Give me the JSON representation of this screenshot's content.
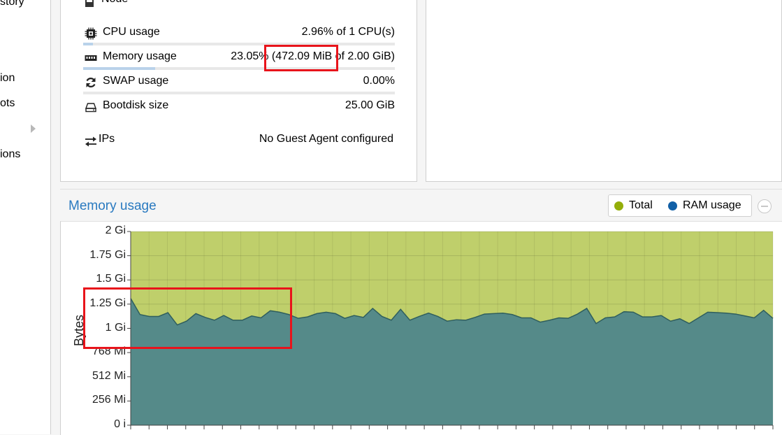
{
  "sidebar": {
    "items": [
      {
        "label": "story"
      },
      {
        "label": "ion"
      },
      {
        "label": "ots"
      },
      {
        "label": "ions"
      }
    ]
  },
  "node_label": "Node",
  "status": {
    "cpu": {
      "label": "CPU usage",
      "value": "2.96% of 1 CPU(s)",
      "fraction": 0.0296
    },
    "memory": {
      "label": "Memory usage",
      "value": "23.05% (472.09 MiB of 2.00 GiB)",
      "fraction": 0.2305
    },
    "swap": {
      "label": "SWAP usage",
      "value": "0.00%",
      "fraction": 0
    },
    "bootdisk": {
      "label": "Bootdisk size",
      "value": "25.00 GiB"
    },
    "ips": {
      "label": "IPs",
      "value": "No Guest Agent configured"
    }
  },
  "chart_header": {
    "title": "Memory usage",
    "legend": [
      {
        "name": "Total",
        "color": "#94ae0a"
      },
      {
        "name": "RAM usage",
        "color": "#115fa6"
      }
    ]
  },
  "chart_data": {
    "type": "area",
    "title": "Memory usage",
    "ylabel": "Bytes",
    "yticks": [
      "0 i",
      "256 Mi",
      "512 Mi",
      "768 Mi",
      "1 Gi",
      "1.25 Gi",
      "1.5 Gi",
      "1.75 Gi",
      "2 Gi"
    ],
    "ylim_mib": [
      0,
      2048
    ],
    "series": [
      {
        "name": "Total",
        "color": "#94ae0a",
        "values_mib": [
          2048,
          2048,
          2048,
          2048,
          2048,
          2048,
          2048,
          2048,
          2048,
          2048,
          2048,
          2048,
          2048,
          2048,
          2048,
          2048,
          2048,
          2048,
          2048,
          2048,
          2048,
          2048,
          2048,
          2048,
          2048,
          2048,
          2048,
          2048,
          2048,
          2048,
          2048,
          2048,
          2048,
          2048,
          2048,
          2048,
          2048,
          2048,
          2048,
          2048,
          2048,
          2048,
          2048,
          2048,
          2048,
          2048,
          2048,
          2048,
          2048,
          2048,
          2048,
          2048,
          2048,
          2048,
          2048,
          2048,
          2048,
          2048,
          2048,
          2048,
          2048,
          2048,
          2048,
          2048,
          2048,
          2048,
          2048,
          2048,
          2048,
          2048
        ]
      },
      {
        "name": "RAM usage",
        "color": "#115fa6",
        "values_mib": [
          1340,
          1170,
          1150,
          1150,
          1190,
          1060,
          1100,
          1180,
          1140,
          1110,
          1160,
          1110,
          1110,
          1155,
          1135,
          1210,
          1195,
          1170,
          1130,
          1145,
          1180,
          1195,
          1180,
          1130,
          1160,
          1140,
          1235,
          1150,
          1110,
          1225,
          1110,
          1150,
          1185,
          1150,
          1100,
          1115,
          1110,
          1140,
          1175,
          1180,
          1185,
          1170,
          1135,
          1135,
          1090,
          1110,
          1135,
          1130,
          1175,
          1235,
          1075,
          1135,
          1145,
          1200,
          1195,
          1145,
          1145,
          1160,
          1100,
          1125,
          1075,
          1135,
          1195,
          1190,
          1185,
          1175,
          1155,
          1135,
          1215,
          1130
        ]
      }
    ]
  },
  "annotations": {
    "color": "#e8141b"
  }
}
